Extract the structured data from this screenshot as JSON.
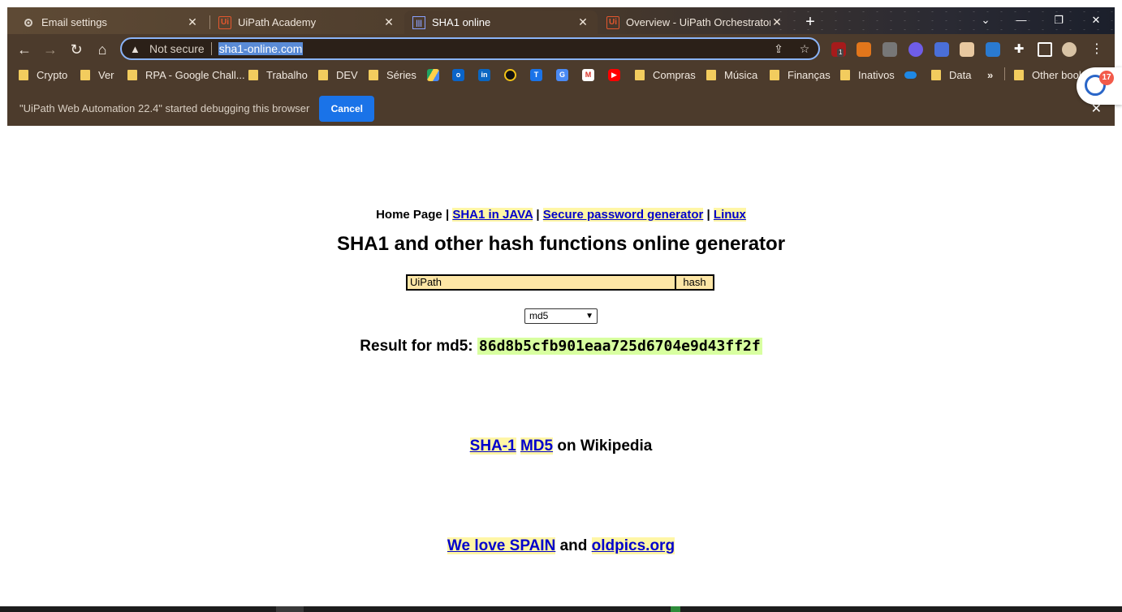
{
  "browser": {
    "tabs": [
      {
        "title": "Email settings",
        "favicon": "gear-icon"
      },
      {
        "title": "UiPath Academy",
        "favicon": "uipath-icon"
      },
      {
        "title": "SHA1 online",
        "favicon": "sha1-icon",
        "active": true
      },
      {
        "title": "Overview - UiPath Orchestrator",
        "favicon": "uipath-icon"
      }
    ],
    "omnibox": {
      "security_label": "Not secure",
      "url": "sha1-online.com"
    },
    "bookmarks": [
      {
        "label": "Crypto",
        "type": "folder"
      },
      {
        "label": "Ver",
        "type": "folder"
      },
      {
        "label": "RPA - Google Chall...",
        "type": "folder"
      },
      {
        "label": "Trabalho",
        "type": "folder"
      },
      {
        "label": "DEV",
        "type": "folder"
      },
      {
        "label": "Séries",
        "type": "folder"
      },
      {
        "label": "Compras",
        "type": "folder"
      },
      {
        "label": "Música",
        "type": "folder"
      },
      {
        "label": "Finanças",
        "type": "folder"
      },
      {
        "label": "Inativos",
        "type": "folder"
      },
      {
        "label": "Data",
        "type": "folder"
      },
      {
        "label": "Other book",
        "type": "folder"
      }
    ],
    "overflow_label": "»",
    "debug_bar": {
      "message": "\"UiPath Web Automation 22.4\" started debugging this browser",
      "cancel_label": "Cancel"
    },
    "assistant_badge": "17",
    "extension_badge": "1"
  },
  "page": {
    "nav": {
      "home": "Home Page",
      "sep": "|",
      "sha1_java": "SHA1 in JAVA",
      "password_gen": "Secure password generator",
      "linux": "Linux"
    },
    "title": "SHA1 and other hash functions online generator",
    "input_value": "UiPath",
    "hash_button": "hash",
    "algorithm": "md5",
    "result_label": "Result for md5:",
    "result_value": "86d8b5cfb901eaa725d6704e9d43ff2f",
    "wiki": {
      "sha1": "SHA-1",
      "md5": "MD5",
      "suffix": "on Wikipedia"
    },
    "footer": {
      "spain": "We love SPAIN",
      "and": "and",
      "oldpics": "oldpics.org"
    }
  },
  "colors": {
    "chrome_bg": "#4c3b2c",
    "accent_blue": "#1a73e8",
    "link": "#0000cc",
    "link_highlight": "#fff6a6",
    "input_bg": "#fde6a6",
    "result_bg": "#d8ffa0"
  }
}
